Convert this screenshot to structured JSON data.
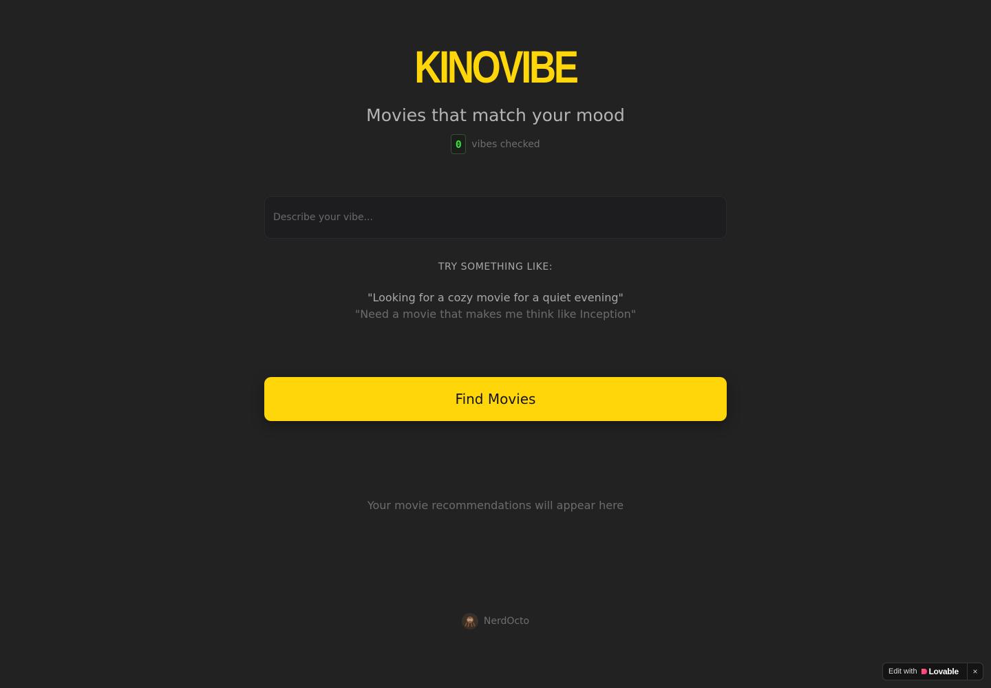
{
  "header": {
    "logo": "KINOVIBE",
    "subtitle": "Movies that match your mood",
    "counter_value": "0",
    "counter_label": "vibes checked"
  },
  "search": {
    "placeholder": "Describe your vibe...",
    "value": ""
  },
  "suggestions": {
    "heading": "TRY SOMETHING LIKE:",
    "items": [
      "\"Looking for a cozy movie for a quiet evening\"",
      "\"Need a movie that makes me think like Inception\""
    ]
  },
  "actions": {
    "find_label": "Find Movies"
  },
  "results": {
    "empty_text": "Your movie recommendations will appear here"
  },
  "footer": {
    "author": "NerdOcto"
  },
  "badge": {
    "edit_with": "Edit with",
    "brand": "Lovable",
    "close": "×"
  },
  "colors": {
    "background": "#222222",
    "accent": "#FFD60A",
    "counter": "#39E33A"
  }
}
